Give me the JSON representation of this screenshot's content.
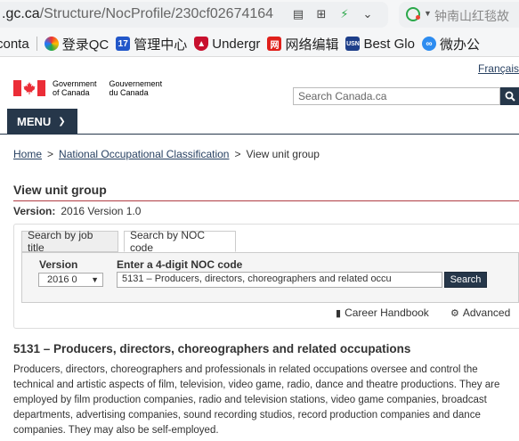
{
  "browser": {
    "url_host": ".gc.ca",
    "url_path": "/Structure/NocProfile/230cf02674164",
    "search_text": "钟南山红毯故",
    "bookmarks": [
      {
        "label": "conta"
      },
      {
        "label": "登录QC"
      },
      {
        "label": "管理中心"
      },
      {
        "label": "Undergr"
      },
      {
        "label": "网络编辑"
      },
      {
        "label": "Best Glo"
      },
      {
        "label": "微办公"
      }
    ]
  },
  "header": {
    "lang_link": "Français",
    "gov_en_1": "Government",
    "gov_en_2": "of Canada",
    "gov_fr_1": "Gouvernement",
    "gov_fr_2": "du Canada",
    "search_placeholder": "Search Canada.ca"
  },
  "menu": {
    "label": "MENU"
  },
  "breadcrumb": {
    "home": "Home",
    "noc": "National Occupational Classification",
    "current": "View unit group"
  },
  "page": {
    "title": "View unit group",
    "version_label": "Version:",
    "version_value": "2016 Version 1.0"
  },
  "search_panel": {
    "tabs": [
      "Search by job title",
      "Search by NOC code"
    ],
    "active_tab": 1,
    "version_label": "Version",
    "version_value": "2016 0",
    "code_label": "Enter a 4-digit NOC code",
    "code_value": "5131 – Producers, directors, choreographers and related occu",
    "search_button": "Search"
  },
  "tools": {
    "career_handbook": "Career Handbook",
    "advanced": "Advanced"
  },
  "unit_group": {
    "title": "5131 – Producers, directors, choreographers and related occupations",
    "description": "Producers, directors, choreographers and professionals in related occupations oversee and control the technical and artistic aspects of film, television, video game, radio, dance and theatre productions. They are employed by film production companies, radio and television stations, video game companies, broadcast departments, advertising companies, sound recording studios, record production companies and dance companies. They may also be self-employed."
  },
  "colors": {
    "navy": "#26374a",
    "link": "#284162",
    "accent_rule": "#af3c43",
    "flag_red": "#eb2d37"
  }
}
